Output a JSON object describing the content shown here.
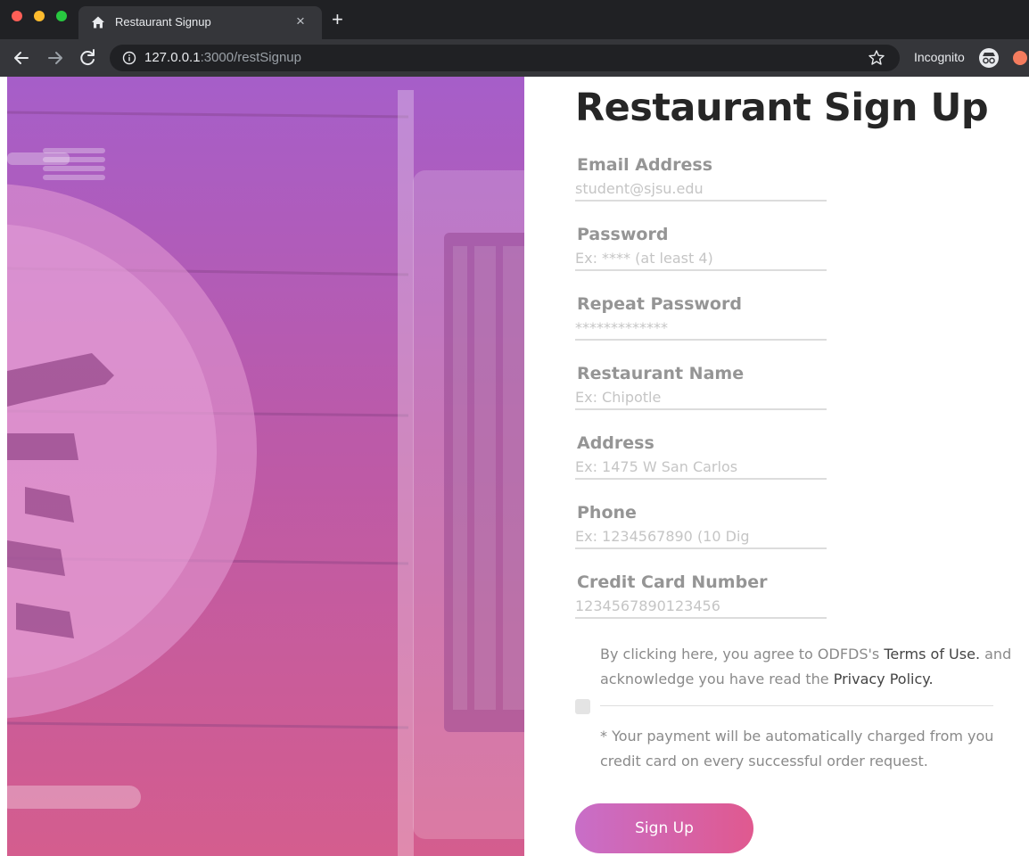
{
  "browser": {
    "tab_title": "Restaurant Signup",
    "url_host": "127.0.0.1",
    "url_path": ":3000/restSignup",
    "incognito_label": "Incognito"
  },
  "form": {
    "heading": "Restaurant Sign Up",
    "fields": [
      {
        "label": "Email Address",
        "placeholder": "student@sjsu.edu"
      },
      {
        "label": "Password",
        "placeholder": "Ex: **** (at least 4)"
      },
      {
        "label": "Repeat Password",
        "placeholder": "*************"
      },
      {
        "label": "Restaurant Name",
        "placeholder": "Ex: Chipotle"
      },
      {
        "label": "Address",
        "placeholder": "Ex: 1475 W San Carlos"
      },
      {
        "label": "Phone",
        "placeholder": "Ex: 1234567890 (10 Dig"
      },
      {
        "label": "Credit Card Number",
        "placeholder": "1234567890123456"
      }
    ],
    "agreement": {
      "prefix": "By clicking here, you agree to ODFDS's ",
      "terms_link": "Terms of Use.",
      "middle": " and acknowledge you have read the ",
      "privacy_link": "Privacy Policy."
    },
    "payment_note": "* Your payment will be automatically charged from you credit card on every successful order request.",
    "submit_label": "Sign Up"
  }
}
